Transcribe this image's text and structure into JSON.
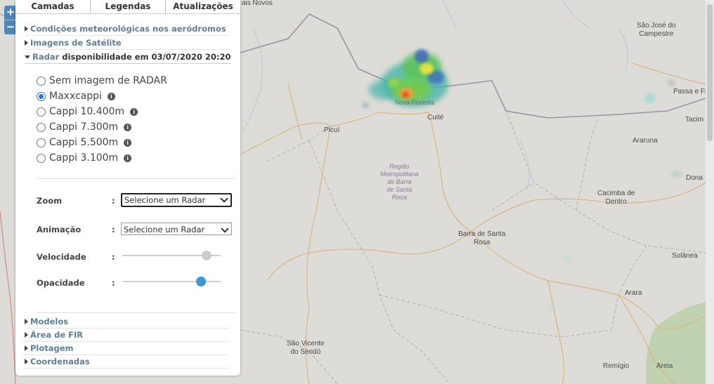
{
  "tabs": [
    "Camadas",
    "Legendas",
    "Atualizações"
  ],
  "accordion": {
    "item1": "Condições meteorológicas nos aeródromos",
    "item2": "Imagens de Satélite",
    "radar_label": "Radar",
    "radar_suffix": "disponibilidade em 03/07/2020 20:20"
  },
  "radar_options": [
    {
      "label": "Sem imagem de RADAR",
      "selected": false,
      "info": false
    },
    {
      "label": "Maxxcappi",
      "selected": true,
      "info": true
    },
    {
      "label": "Cappi 10.400m",
      "selected": false,
      "info": true
    },
    {
      "label": "Cappi 7.300m",
      "selected": false,
      "info": true
    },
    {
      "label": "Cappi 5.500m",
      "selected": false,
      "info": true
    },
    {
      "label": "Cappi 3.100m",
      "selected": false,
      "info": true
    }
  ],
  "controls": {
    "zoom_label": "Zoom",
    "zoom_value": "Selecione um Radar",
    "animation_label": "Animação",
    "animation_value": "Selecione um Radar",
    "speed_label": "Velocidade",
    "speed_level": 0.9,
    "opacity_label": "Opacidade",
    "opacity_level": 0.83,
    "colon": ":"
  },
  "lower_accordion": [
    "Modelos",
    "Área de FIR",
    "Plotagem",
    "Coordenadas"
  ],
  "map": {
    "zoom_in": "+",
    "zoom_out": "−",
    "labels": {
      "pedras": "ais Novos",
      "sao_jose": "São José do\nCampestre",
      "passa": "Passa e Fi",
      "tacima": "Tacim",
      "picui": "Picuí",
      "cuite": "Cuité",
      "nova_floresta": "Nova Floresta",
      "regiao": "Região\nMetropolitana\nde Barra\nde Santa\nRosa",
      "arara_top": "Araruna",
      "dona": "Dona",
      "cacimba": "Cacimba de\nDentro",
      "barra": "Barra de Santa\nRosa",
      "solanea": "Solânea",
      "arara": "Arara",
      "sao_vicente": "São Vicente\ndo Seridó",
      "remigio": "Remígio",
      "areia": "Areia"
    }
  },
  "colors": {
    "accent": "#2c7ad6",
    "slider_speed": "#cccccc",
    "slider_opacity": "#3d98d8",
    "accordion_text": "#5f7f94",
    "zoom_button": "#4e86b8"
  }
}
